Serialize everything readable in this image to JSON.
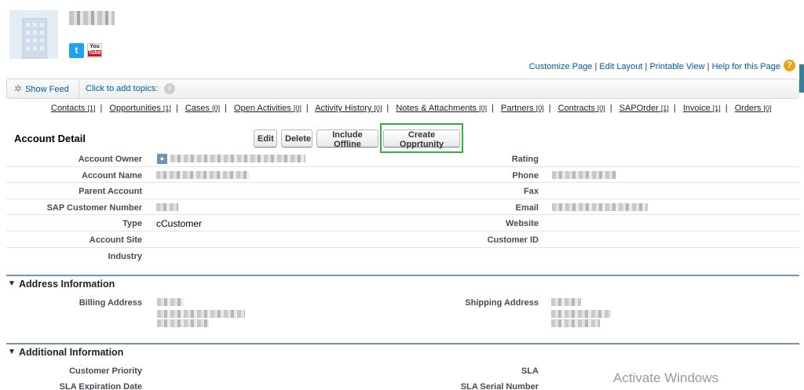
{
  "header": {
    "social": {
      "twitter_icon": "twitter-icon",
      "youtube_top": "You",
      "youtube_bottom": "Tube"
    },
    "top_links": [
      {
        "label": "Customize Page"
      },
      {
        "label": "Edit Layout"
      },
      {
        "label": "Printable View"
      },
      {
        "label": "Help for this Page"
      }
    ],
    "help_glyph": "?"
  },
  "feed_bar": {
    "show_feed": "Show Feed",
    "topics": "Click to add topics:",
    "info_glyph": "i"
  },
  "related_links": [
    {
      "label": "Contacts",
      "count": "[1]"
    },
    {
      "label": "Opportunities",
      "count": "[1]"
    },
    {
      "label": "Cases",
      "count": "[0]"
    },
    {
      "label": "Open Activities",
      "count": "[0]"
    },
    {
      "label": "Activity History",
      "count": "[0]"
    },
    {
      "label": "Notes & Attachments",
      "count": "[0]"
    },
    {
      "label": "Partners",
      "count": "[0]"
    },
    {
      "label": "Contracts",
      "count": "[0]"
    },
    {
      "label": "SAPOrder",
      "count": "[1]"
    },
    {
      "label": "Invoice",
      "count": "[1]"
    },
    {
      "label": "Orders",
      "count": "[0]"
    }
  ],
  "detail": {
    "title": "Account Detail",
    "buttons": {
      "edit": "Edit",
      "delete": "Delete",
      "include_offline": "Include Offline",
      "create_opportunity": "Create Opprtunity"
    },
    "rows": [
      {
        "left_label": "Account Owner",
        "left_value": "",
        "right_label": "Rating",
        "right_value": ""
      },
      {
        "left_label": "Account Name",
        "left_value": "",
        "right_label": "Phone",
        "right_value": ""
      },
      {
        "left_label": "Parent Account",
        "left_value": "",
        "right_label": "Fax",
        "right_value": ""
      },
      {
        "left_label": "SAP Customer Number",
        "left_value": "",
        "right_label": "Email",
        "right_value": ""
      },
      {
        "left_label": "Type",
        "left_value": "cCustomer",
        "right_label": "Website",
        "right_value": ""
      },
      {
        "left_label": "Account Site",
        "left_value": "",
        "right_label": "Customer ID",
        "right_value": ""
      },
      {
        "left_label": "Industry",
        "left_value": "",
        "right_label": "",
        "right_value": ""
      }
    ]
  },
  "address_section": {
    "title": "Address Information",
    "billing_label": "Billing Address",
    "shipping_label": "Shipping Address"
  },
  "additional_section": {
    "title": "Additional Information",
    "rows": [
      {
        "left_label": "Customer Priority",
        "right_label": "SLA"
      },
      {
        "left_label": "SLA Expiration Date",
        "right_label": "SLA Serial Number"
      }
    ]
  },
  "watermark": "Activate Windows",
  "colors": {
    "link": "#015ba7",
    "highlight_border": "#2fb33e",
    "section_rule": "#7892b0"
  }
}
